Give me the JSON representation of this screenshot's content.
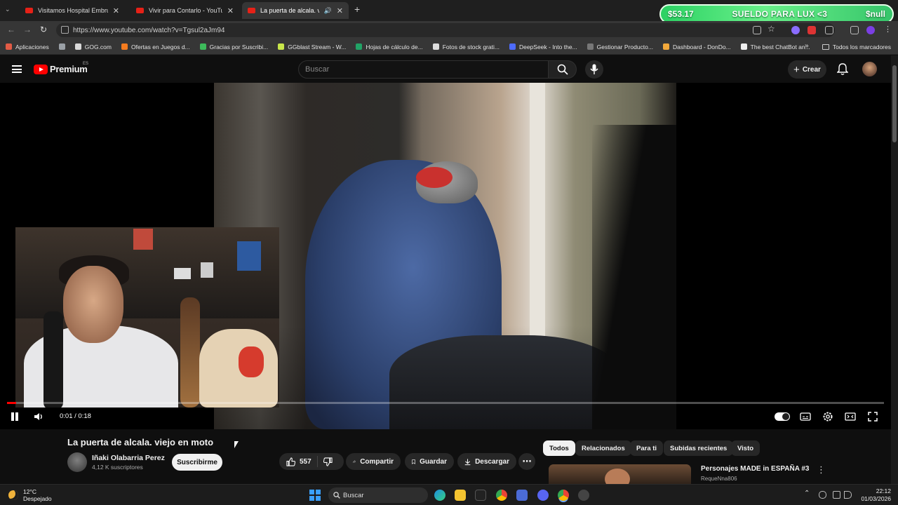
{
  "browser": {
    "tabs": [
      {
        "label": "Visitamos Hospital Embrujado c",
        "active": false
      },
      {
        "label": "Vivir para Contarlo - YouTube",
        "active": false
      },
      {
        "label": "La puerta de alcala. viejo en",
        "active": true
      }
    ],
    "url": "https://www.youtube.com/watch?v=Tgsul2aJm94",
    "bookmarks": [
      {
        "label": "Aplicaciones",
        "color": "#e25b45"
      },
      {
        "label": "",
        "color": "#9aa0a6"
      },
      {
        "label": "GOG.com",
        "color": "#d9d9d9"
      },
      {
        "label": "Ofertas en Juegos d...",
        "color": "#f57c1f"
      },
      {
        "label": "Gracias por Suscribi...",
        "color": "#3dbb5b"
      },
      {
        "label": "GGblast Stream - W...",
        "color": "#c8e64a"
      },
      {
        "label": "Hojas de cálculo de...",
        "color": "#21a366"
      },
      {
        "label": "Fotos de stock grati...",
        "color": "#dddddd"
      },
      {
        "label": "DeepSeek - Into the...",
        "color": "#4d6bfe"
      },
      {
        "label": "Gestionar Producto...",
        "color": "#777777"
      },
      {
        "label": "Dashboard - DonDo...",
        "color": "#f2a93b"
      },
      {
        "label": "The best ChatBot an...",
        "color": "#eeeeee"
      }
    ],
    "all_bookmarks": "Todos los marcadores"
  },
  "stream_banner": {
    "money": "$53.17",
    "title": "SUELDO PARA LUX <3",
    "user": "$null"
  },
  "youtube": {
    "logo_text": "Premium",
    "region": "ES",
    "search_placeholder": "Buscar",
    "create_label": "Crear",
    "player": {
      "time": "0:01 / 0:18",
      "progress_fraction": 0.01
    },
    "video": {
      "title": "La puerta de alcala. viejo en moto",
      "channel": "Iñaki Olabarria Perez",
      "subscribers": "4,12 K suscriptores",
      "subscribe_label": "Suscribirme",
      "likes": "557",
      "share_label": "Compartir",
      "save_label": "Guardar",
      "download_label": "Descargar"
    },
    "chips": [
      {
        "label": "Todos",
        "active": true
      },
      {
        "label": "Relacionados",
        "active": false
      },
      {
        "label": "Para ti",
        "active": false
      },
      {
        "label": "Subidas recientes",
        "active": false
      },
      {
        "label": "Visto",
        "active": false
      }
    ],
    "recommendation": {
      "title": "Personajes MADE in ESPAÑA #3",
      "channel": "RequeNna806"
    }
  },
  "taskbar": {
    "temperature": "12°C",
    "condition": "Despejado",
    "search_label": "Buscar",
    "time": "22:12",
    "date": "01/03/2026"
  }
}
